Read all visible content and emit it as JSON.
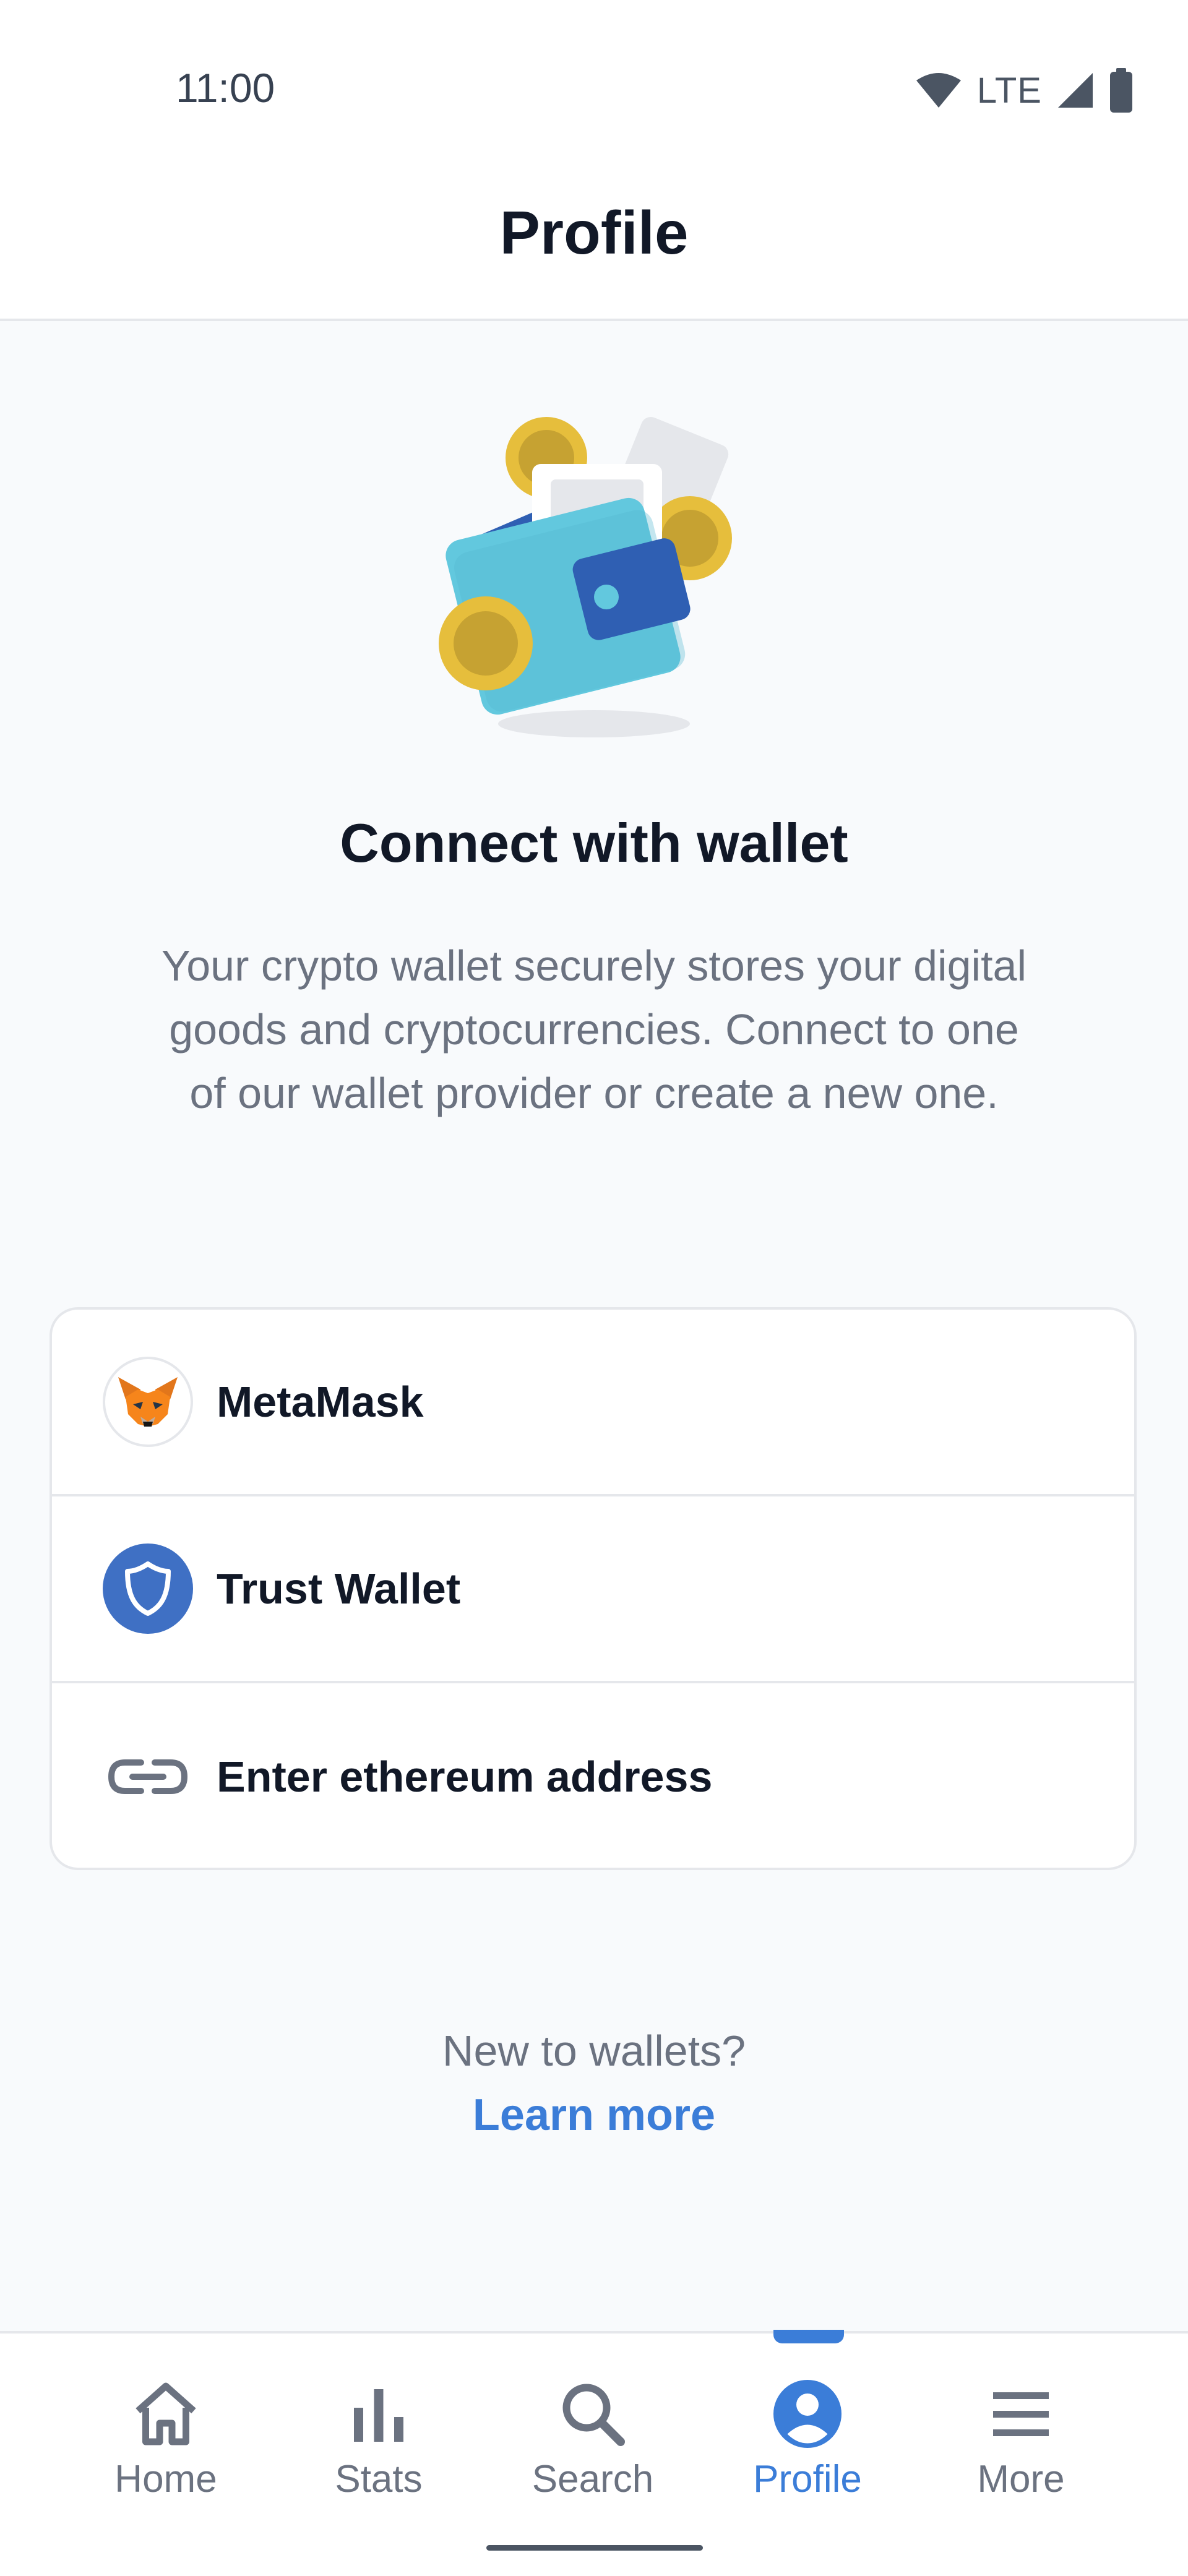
{
  "status_bar": {
    "time": "11:00",
    "network": "LTE"
  },
  "header": {
    "title": "Profile"
  },
  "main": {
    "heading": "Connect with wallet",
    "description": "Your crypto wallet securely stores your digital goods and cryptocurrencies. Connect to one of our wallet provider or create a new one.",
    "wallets": [
      {
        "label": "MetaMask",
        "icon": "metamask-fox-icon"
      },
      {
        "label": "Trust Wallet",
        "icon": "shield-icon"
      },
      {
        "label": "Enter ethereum address",
        "icon": "link-icon"
      }
    ],
    "new_to_wallets": "New to wallets?",
    "learn_more": "Learn more"
  },
  "bottom_nav": {
    "items": [
      {
        "label": "Home",
        "icon": "home-icon"
      },
      {
        "label": "Stats",
        "icon": "bar-chart-icon"
      },
      {
        "label": "Search",
        "icon": "search-icon"
      },
      {
        "label": "Profile",
        "icon": "account-circle-icon",
        "active": true
      },
      {
        "label": "More",
        "icon": "menu-icon"
      }
    ]
  },
  "colors": {
    "accent": "#3B7DD8",
    "text": "#111827",
    "muted": "#6B7280",
    "background": "#F8FAFC"
  }
}
